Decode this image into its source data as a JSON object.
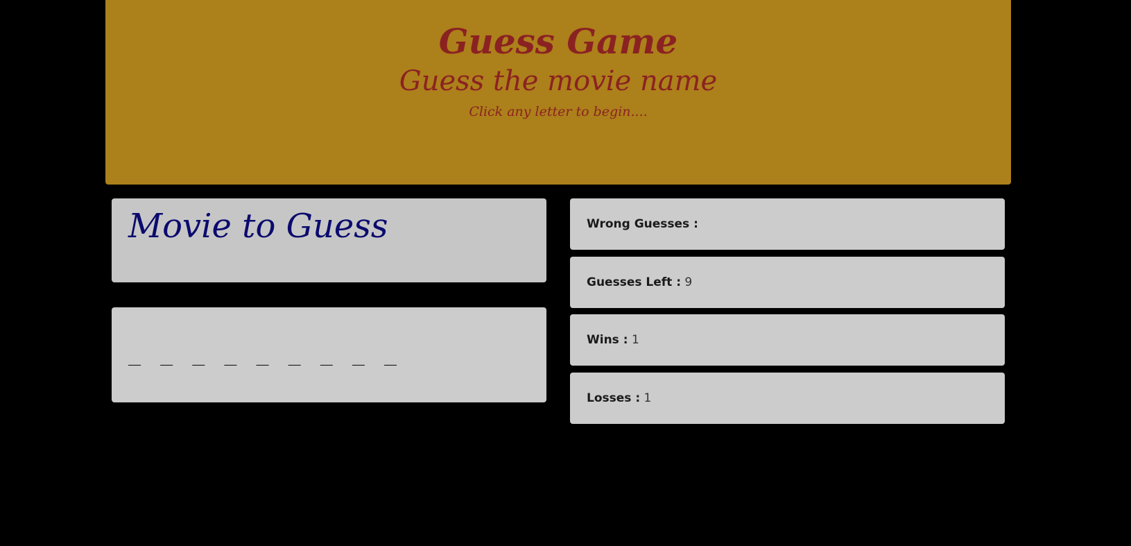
{
  "header": {
    "title": "Guess Game",
    "subtitle": "Guess the movie name",
    "instruction": "Click any letter to begin...."
  },
  "movie_panel": {
    "heading": "Movie to Guess"
  },
  "word_panel": {
    "blanks": "_ _ _ _ _ _ _ _ _"
  },
  "stats": {
    "wrong_guesses": {
      "label": "Wrong Guesses :",
      "value": ""
    },
    "guesses_left": {
      "label": "Guesses Left :",
      "value": "9"
    },
    "wins": {
      "label": "Wins :",
      "value": "1"
    },
    "losses": {
      "label": "Losses :",
      "value": "1"
    }
  },
  "colors": {
    "background": "#000000",
    "jumbotron": "#ac801a",
    "header_text": "#8b2222",
    "panel": "#cccccc",
    "movie_heading": "#0a0a6e"
  }
}
